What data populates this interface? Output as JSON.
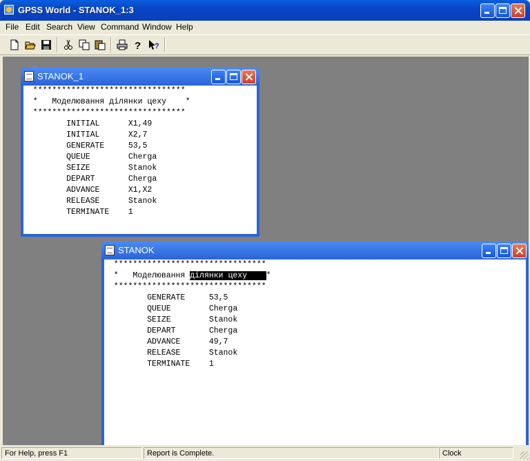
{
  "app": {
    "title": "GPSS World - STANOK_1:3"
  },
  "menu": [
    "File",
    "Edit",
    "Search",
    "View",
    "Command",
    "Window",
    "Help"
  ],
  "toolbar": {
    "icons": [
      "new-icon",
      "open-icon",
      "save-icon",
      "cut-icon",
      "copy-icon",
      "paste-icon",
      "print-icon",
      "help-icon",
      "context-help-icon"
    ]
  },
  "win1": {
    "title": "STANOK_1",
    "lines": [
      "  ********************************",
      "  *   Моделювання ділянки цеху    *",
      "  ********************************",
      "         INITIAL      X1,49",
      "         INITIAL      X2,7",
      "         GENERATE     53,5",
      "         QUEUE        Cherga",
      "         SEIZE        Stanok",
      "         DEPART       Cherga",
      "         ADVANCE      X1,X2",
      "         RELEASE      Stanok",
      "         TERMINATE    1"
    ]
  },
  "win2": {
    "title": "STANOK",
    "line1": "  ********************************",
    "line2_pre": "  *   Моделювання ",
    "line2_sel": "ділянки цеху    ",
    "line2_post": "*",
    "line3": "  ********************************",
    "lines": [
      "         GENERATE     53,5",
      "         QUEUE        Cherga",
      "         SEIZE        Stanok",
      "         DEPART       Cherga",
      "         ADVANCE      49,7",
      "         RELEASE      Stanok",
      "         TERMINATE    1"
    ]
  },
  "status": {
    "help": "For Help, press F1",
    "report": "Report is Complete.",
    "clock": "Clock"
  }
}
